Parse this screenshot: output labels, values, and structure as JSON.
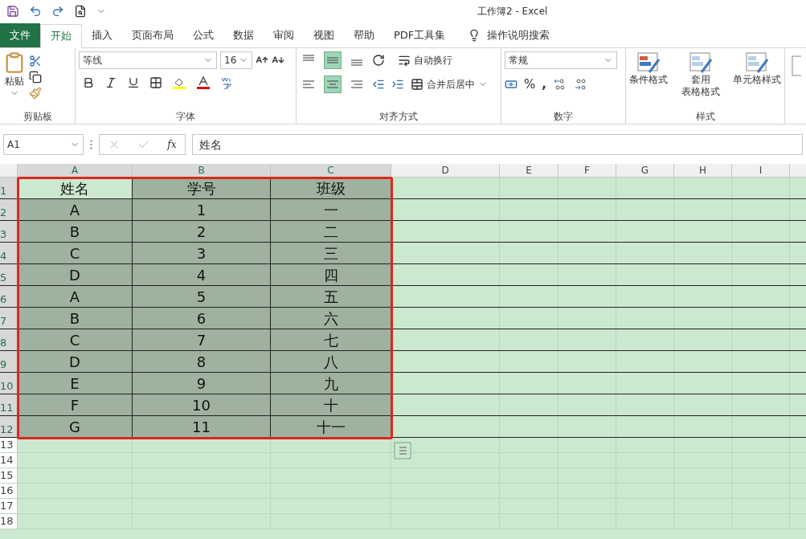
{
  "window": {
    "title": "工作簿2  -  Excel"
  },
  "tabs": [
    {
      "label": "文件",
      "kind": "file",
      "selected": false
    },
    {
      "label": "开始",
      "kind": "tab",
      "selected": true
    },
    {
      "label": "插入",
      "kind": "tab",
      "selected": false
    },
    {
      "label": "页面布局",
      "kind": "tab",
      "selected": false
    },
    {
      "label": "公式",
      "kind": "tab",
      "selected": false
    },
    {
      "label": "数据",
      "kind": "tab",
      "selected": false
    },
    {
      "label": "审阅",
      "kind": "tab",
      "selected": false
    },
    {
      "label": "视图",
      "kind": "tab",
      "selected": false
    },
    {
      "label": "帮助",
      "kind": "tab",
      "selected": false
    },
    {
      "label": "PDF工具集",
      "kind": "tab",
      "selected": false
    },
    {
      "label": "操作说明搜索",
      "kind": "search",
      "selected": false
    }
  ],
  "ribbon": {
    "clipboard": {
      "paste_label": "粘贴",
      "title": "剪贴板"
    },
    "font": {
      "font_name": "等线",
      "font_size": "16",
      "title": "字体"
    },
    "alignment": {
      "vertical": [
        {
          "selected": false
        },
        {
          "selected": true
        },
        {
          "selected": false
        }
      ],
      "horizontal": [
        {
          "selected": false
        },
        {
          "selected": true
        },
        {
          "selected": false
        }
      ],
      "wrap_label": "自动换行",
      "merge_label": "合并后居中",
      "title": "对齐方式"
    },
    "number": {
      "format": "常规",
      "percent_symbol": "%",
      "comma_symbol": ",",
      "title": "数字"
    },
    "styles": {
      "buttons": [
        {
          "lines": [
            "条件格式"
          ]
        },
        {
          "lines": [
            "套用",
            "表格格式"
          ]
        },
        {
          "lines": [
            "单元格样式"
          ]
        }
      ],
      "title": "样式"
    }
  },
  "formula_bar": {
    "name_box": "A1",
    "function_symbol": "fx",
    "value": "姓名"
  },
  "grid": {
    "columns": [
      {
        "header": "A",
        "selected": true
      },
      {
        "header": "B",
        "selected": true
      },
      {
        "header": "C",
        "selected": true
      },
      {
        "header": "D",
        "selected": false
      },
      {
        "header": "E",
        "selected": false
      },
      {
        "header": "F",
        "selected": false
      },
      {
        "header": "G",
        "selected": false
      },
      {
        "header": "H",
        "selected": false
      },
      {
        "header": "I",
        "selected": false
      }
    ],
    "rows": [
      {
        "header": "1",
        "selected": true,
        "cells": [
          {
            "text": "姓名",
            "active": true
          },
          {
            "text": "学号",
            "active": false
          },
          {
            "text": "班级",
            "active": false
          }
        ]
      },
      {
        "header": "2",
        "selected": true,
        "cells": [
          {
            "text": "A",
            "active": false
          },
          {
            "text": "1",
            "active": false
          },
          {
            "text": "一",
            "active": false
          }
        ]
      },
      {
        "header": "3",
        "selected": true,
        "cells": [
          {
            "text": "B",
            "active": false
          },
          {
            "text": "2",
            "active": false
          },
          {
            "text": "二",
            "active": false
          }
        ]
      },
      {
        "header": "4",
        "selected": true,
        "cells": [
          {
            "text": "C",
            "active": false
          },
          {
            "text": "3",
            "active": false
          },
          {
            "text": "三",
            "active": false
          }
        ]
      },
      {
        "header": "5",
        "selected": true,
        "cells": [
          {
            "text": "D",
            "active": false
          },
          {
            "text": "4",
            "active": false
          },
          {
            "text": "四",
            "active": false
          }
        ]
      },
      {
        "header": "6",
        "selected": true,
        "cells": [
          {
            "text": "A",
            "active": false
          },
          {
            "text": "5",
            "active": false
          },
          {
            "text": "五",
            "active": false
          }
        ]
      },
      {
        "header": "7",
        "selected": true,
        "cells": [
          {
            "text": "B",
            "active": false
          },
          {
            "text": "6",
            "active": false
          },
          {
            "text": "六",
            "active": false
          }
        ]
      },
      {
        "header": "8",
        "selected": true,
        "cells": [
          {
            "text": "C",
            "active": false
          },
          {
            "text": "7",
            "active": false
          },
          {
            "text": "七",
            "active": false
          }
        ]
      },
      {
        "header": "9",
        "selected": true,
        "cells": [
          {
            "text": "D",
            "active": false
          },
          {
            "text": "8",
            "active": false
          },
          {
            "text": "八",
            "active": false
          }
        ]
      },
      {
        "header": "10",
        "selected": true,
        "cells": [
          {
            "text": "E",
            "active": false
          },
          {
            "text": "9",
            "active": false
          },
          {
            "text": "九",
            "active": false
          }
        ]
      },
      {
        "header": "11",
        "selected": true,
        "cells": [
          {
            "text": "F",
            "active": false
          },
          {
            "text": "10",
            "active": false
          },
          {
            "text": "十",
            "active": false
          }
        ]
      },
      {
        "header": "12",
        "selected": true,
        "cells": [
          {
            "text": "G",
            "active": false
          },
          {
            "text": "11",
            "active": false
          },
          {
            "text": "十一",
            "active": false
          }
        ]
      },
      {
        "header": "13",
        "selected": false
      },
      {
        "header": "14",
        "selected": false
      },
      {
        "header": "15",
        "selected": false
      },
      {
        "header": "16",
        "selected": false
      },
      {
        "header": "17",
        "selected": false
      },
      {
        "header": "18",
        "selected": false
      }
    ],
    "highlight_frame": true
  }
}
